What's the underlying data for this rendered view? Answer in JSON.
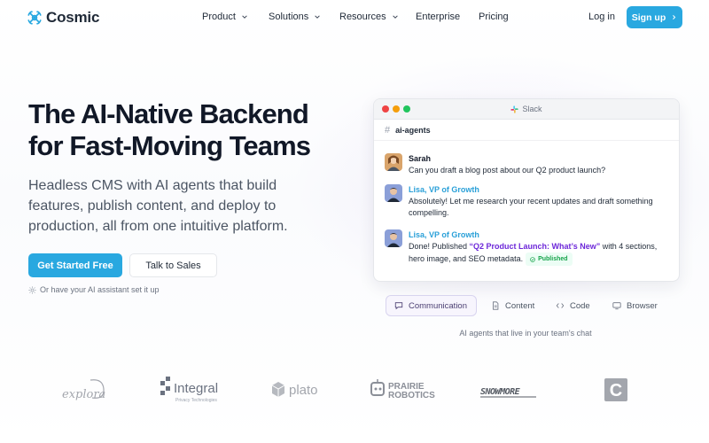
{
  "brand": {
    "name": "Cosmic",
    "accent": "#29a8e0"
  },
  "nav": {
    "items": [
      {
        "label": "Product",
        "dropdown": true
      },
      {
        "label": "Solutions",
        "dropdown": true
      },
      {
        "label": "Resources",
        "dropdown": true
      },
      {
        "label": "Enterprise",
        "dropdown": false
      },
      {
        "label": "Pricing",
        "dropdown": false
      }
    ],
    "login_label": "Log in",
    "signup_label": "Sign up"
  },
  "hero": {
    "title_line1": "The AI-Native Backend",
    "title_line2": "for Fast-Moving Teams",
    "subtitle": "Headless CMS with AI agents that build features, publish content, and deploy to production, all from one intuitive platform.",
    "primary_cta": "Get Started Free",
    "secondary_cta": "Talk to Sales",
    "hint": "Or have your AI assistant set it up"
  },
  "demo_window": {
    "app_title": "Slack",
    "channel": "ai-agents",
    "messages": [
      {
        "author": "Sarah",
        "text": "Can you draft a blog post about our Q2 product launch?"
      },
      {
        "author": "Lisa, VP of Growth",
        "text": "Absolutely! Let me research your recent updates and draft something compelling."
      },
      {
        "author": "Lisa, VP of Growth",
        "text_before": "Done! Published ",
        "quote": "“Q2 Product Launch: What’s New”",
        "text_after": " with 4 sections, hero image, and SEO metadata.",
        "badge": "Published"
      }
    ]
  },
  "tabs": {
    "items": [
      {
        "label": "Communication",
        "icon": "chat-icon",
        "active": true
      },
      {
        "label": "Content",
        "icon": "document-icon",
        "active": false
      },
      {
        "label": "Code",
        "icon": "code-icon",
        "active": false
      },
      {
        "label": "Browser",
        "icon": "monitor-icon",
        "active": false
      }
    ],
    "caption": "AI agents that live in your team's chat"
  },
  "customer_logos": {
    "items": [
      {
        "name": "explora"
      },
      {
        "name": "Integral",
        "tagline": "Privacy Technologies"
      },
      {
        "name": "plato"
      },
      {
        "name": "PRAIRIE",
        "line2": "ROBOTICS"
      },
      {
        "name": "SNOWMORE"
      },
      {
        "name": "C"
      }
    ]
  }
}
